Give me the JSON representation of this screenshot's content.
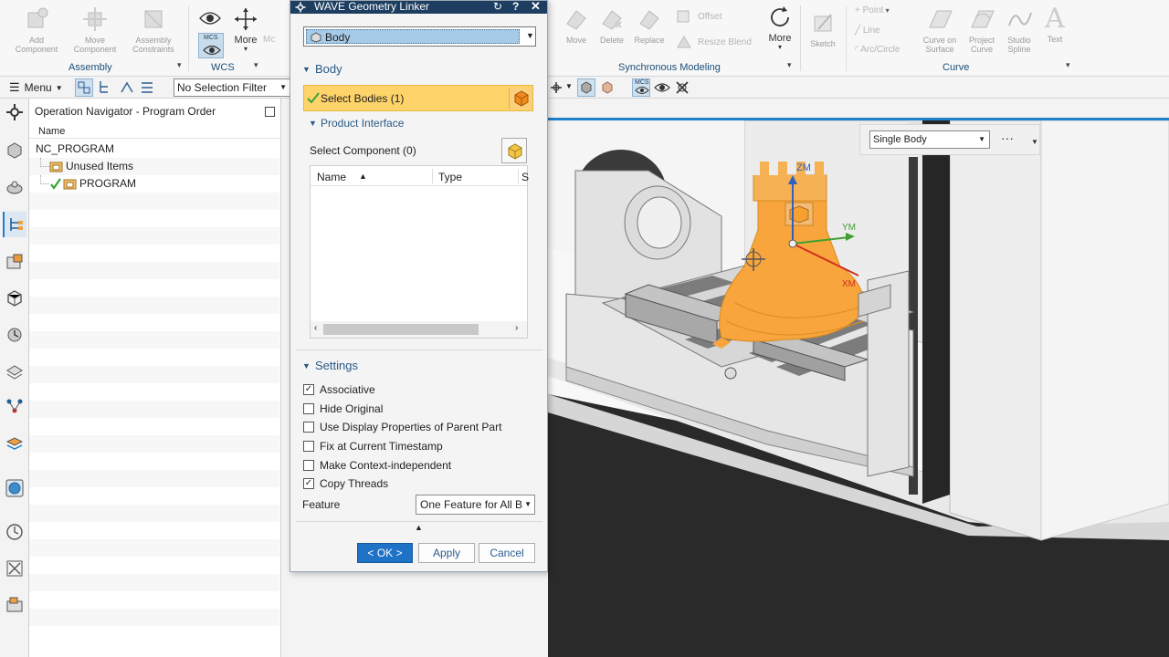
{
  "ribbon": {
    "buttons": [
      {
        "label": "Add Component"
      },
      {
        "label": "Move Component"
      },
      {
        "label": "Assembly Constraints"
      },
      {
        "label": "More"
      },
      {
        "label": "Move"
      },
      {
        "label": "Delete"
      },
      {
        "label": "Replace"
      },
      {
        "label": "Offset"
      },
      {
        "label": "Resize Blend"
      },
      {
        "label": "More"
      },
      {
        "label": "Sketch"
      },
      {
        "label": "Point"
      },
      {
        "label": "Line"
      },
      {
        "label": "Arc/Circle"
      },
      {
        "label": "Curve on Surface"
      },
      {
        "label": "Project Curve"
      },
      {
        "label": "Studio Spline"
      },
      {
        "label": "Text"
      }
    ],
    "groups": {
      "assembly": "Assembly",
      "wcs": "WCS",
      "synchronous": "Synchronous Modeling",
      "curve": "Curve"
    },
    "wcs_badge": "MCS"
  },
  "toolbar": {
    "menu_label": "Menu",
    "selection_filter": "No Selection Filter",
    "mcs_badge": "MCS"
  },
  "navigator": {
    "title": "Operation Navigator - Program Order",
    "column_name": "Name",
    "rows": [
      {
        "label": "NC_PROGRAM"
      },
      {
        "label": "Unused Items"
      },
      {
        "label": "PROGRAM"
      }
    ]
  },
  "dialog": {
    "title": "WAVE Geometry Linker",
    "type_value": "Body",
    "body_section": "Body",
    "select_bodies": "Select Bodies (1)",
    "product_interface": "Product Interface",
    "select_component": "Select Component (0)",
    "table_columns": [
      "Name",
      "Type",
      "S"
    ],
    "settings_section": "Settings",
    "checkboxes": [
      {
        "label": "Associative",
        "checked": true
      },
      {
        "label": "Hide Original",
        "checked": false
      },
      {
        "label": "Use Display Properties of Parent Part",
        "checked": false
      },
      {
        "label": "Fix at Current Timestamp",
        "checked": false
      },
      {
        "label": "Make Context-independent",
        "checked": false
      },
      {
        "label": "Copy Threads",
        "checked": true
      }
    ],
    "feature_label": "Feature",
    "feature_value": "One Feature for All Bo",
    "ok_label": "< OK >",
    "apply_label": "Apply",
    "cancel_label": "Cancel"
  },
  "viewport": {
    "body_filter": "Single Body",
    "more_dots": "···",
    "axis_labels": {
      "z": "ZM",
      "y": "YM",
      "x": "XM"
    }
  },
  "colors": {
    "accent": "#1f7fc7",
    "title_bar": "#1d3e60",
    "selection_highlight": "#fdd36a",
    "part_orange": "#f7a53c"
  }
}
